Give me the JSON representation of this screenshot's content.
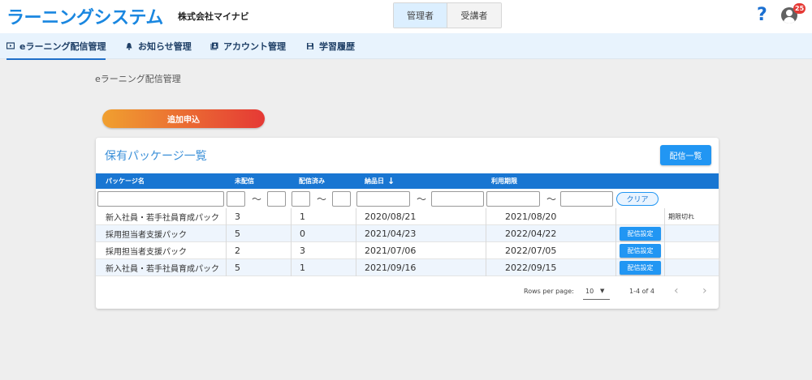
{
  "header": {
    "logo": "ラーニングシステム",
    "company": "株式会社マイナビ",
    "roles": [
      "管理者",
      "受講者"
    ],
    "active_role": "管理者",
    "help_icon": "help-icon",
    "user_icon": "account-circle-icon",
    "notification_count": "25"
  },
  "nav": {
    "items": [
      {
        "label": "eラーニング配信管理",
        "icon": "monitor-play-icon",
        "active": true
      },
      {
        "label": "お知らせ管理",
        "icon": "bell-icon",
        "active": false
      },
      {
        "label": "アカウント管理",
        "icon": "account-box-icon",
        "active": false
      },
      {
        "label": "学習履歴",
        "icon": "save-icon",
        "active": false
      }
    ]
  },
  "breadcrumb": "eラーニング配信管理",
  "add_button": "追加申込",
  "card": {
    "title": "保有パッケージ一覧",
    "list_button": "配信一覧"
  },
  "table": {
    "columns": [
      "パッケージ名",
      "未配信",
      "配信済み",
      "納品日",
      "利用期限"
    ],
    "sorted_column": "納品日",
    "sort_direction": "desc",
    "filter_separator": "〜",
    "clear_button": "クリア",
    "rows": [
      {
        "name": "新入社員・若手社員育成パック",
        "undelivered": "3",
        "delivered": "1",
        "delivery_date": "2020/08/21",
        "expiry": "2021/08/20",
        "action": "",
        "status": "期限切れ"
      },
      {
        "name": "採用担当者支援パック",
        "undelivered": "5",
        "delivered": "0",
        "delivery_date": "2021/04/23",
        "expiry": "2022/04/22",
        "action": "配信設定",
        "status": ""
      },
      {
        "name": "採用担当者支援パック",
        "undelivered": "2",
        "delivered": "3",
        "delivery_date": "2021/07/06",
        "expiry": "2022/07/05",
        "action": "配信設定",
        "status": ""
      },
      {
        "name": "新入社員・若手社員育成パック",
        "undelivered": "5",
        "delivered": "1",
        "delivery_date": "2021/09/16",
        "expiry": "2022/09/15",
        "action": "配信設定",
        "status": ""
      }
    ]
  },
  "pagination": {
    "rows_per_page_label": "Rows per page:",
    "rows_per_page": "10",
    "range": "1-4 of 4",
    "prev_icon": "chevron-left-icon",
    "next_icon": "chevron-right-icon"
  },
  "colors": {
    "brand": "#1a87e0",
    "table_header": "#1976d2",
    "primary_button": "#2196f3",
    "add_gradient_start": "#f0a030",
    "add_gradient_end": "#e53935",
    "nav_bg": "#e8f3fd",
    "page_bg": "#eeeeee"
  }
}
